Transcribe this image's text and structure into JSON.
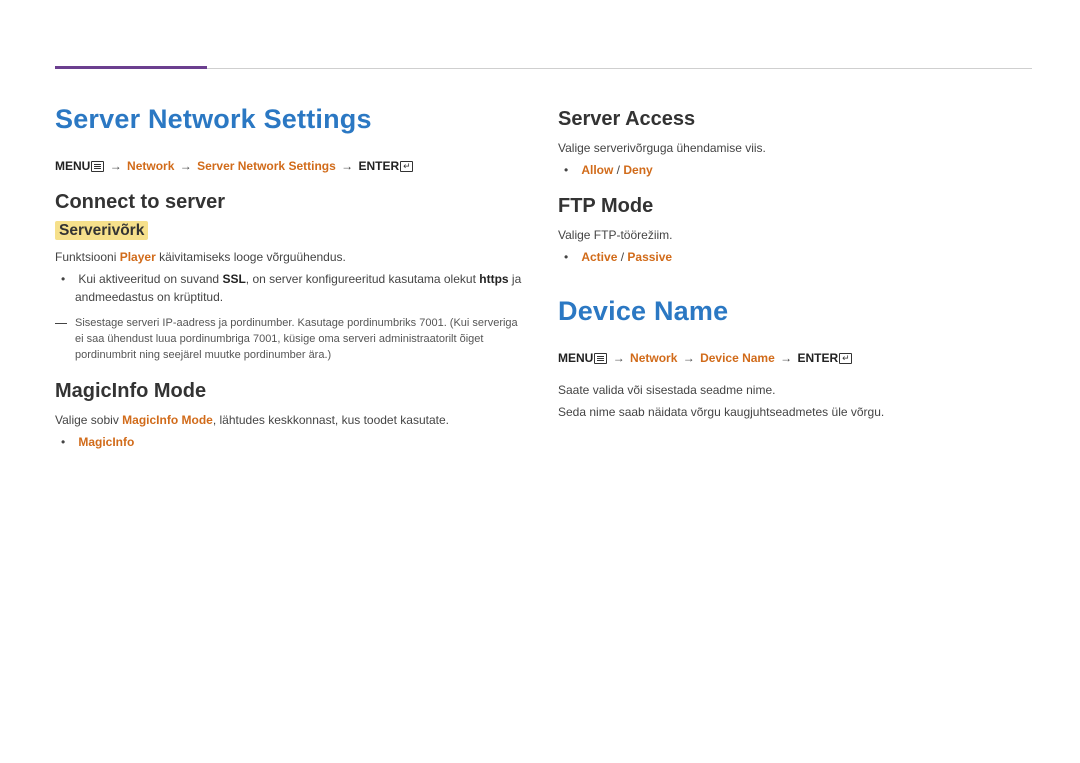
{
  "left": {
    "title": "Server Network Settings",
    "breadcrumb": {
      "menu": "MENU",
      "p1": "Network",
      "p2": "Server Network Settings",
      "enter": "ENTER"
    },
    "connect": {
      "heading": "Connect to server",
      "sub": "Serverivõrk",
      "line1_pre": "Funktsiooni ",
      "line1_hl": "Player",
      "line1_post": " käivitamiseks looge võrguühendus.",
      "bullet_pre": "Kui aktiveeritud on suvand ",
      "bullet_hl": "SSL",
      "bullet_mid": ", on server konfigureeritud kasutama olekut ",
      "bullet_hl2": "https",
      "bullet_post": " ja andmeedastus on krüptitud.",
      "note": "Sisestage serveri IP-aadress ja pordinumber. Kasutage pordinumbriks 7001. (Kui serveriga ei saa ühendust luua pordinumbriga 7001, küsige oma serveri administraatorilt õiget pordinumbrit ning seejärel muutke pordinumber ära.)"
    },
    "magic": {
      "heading": "MagicInfo Mode",
      "line_pre": "Valige sobiv ",
      "line_hl": "MagicInfo Mode",
      "line_post": ", lähtudes keskkonnast, kus toodet kasutate.",
      "option": "MagicInfo"
    }
  },
  "right": {
    "access": {
      "heading": "Server Access",
      "line": "Valige serverivõrguga ühendamise viis.",
      "opt_a": "Allow",
      "slash": " / ",
      "opt_b": "Deny"
    },
    "ftp": {
      "heading": "FTP Mode",
      "line": "Valige FTP-töörežiim.",
      "opt_a": "Active",
      "slash": " / ",
      "opt_b": "Passive"
    },
    "device": {
      "title": "Device Name",
      "breadcrumb": {
        "menu": "MENU",
        "p1": "Network",
        "p2": "Device Name",
        "enter": "ENTER"
      },
      "line1": "Saate valida või sisestada seadme nime.",
      "line2": "Seda nime saab näidata võrgu kaugjuhtseadmetes üle võrgu."
    }
  }
}
